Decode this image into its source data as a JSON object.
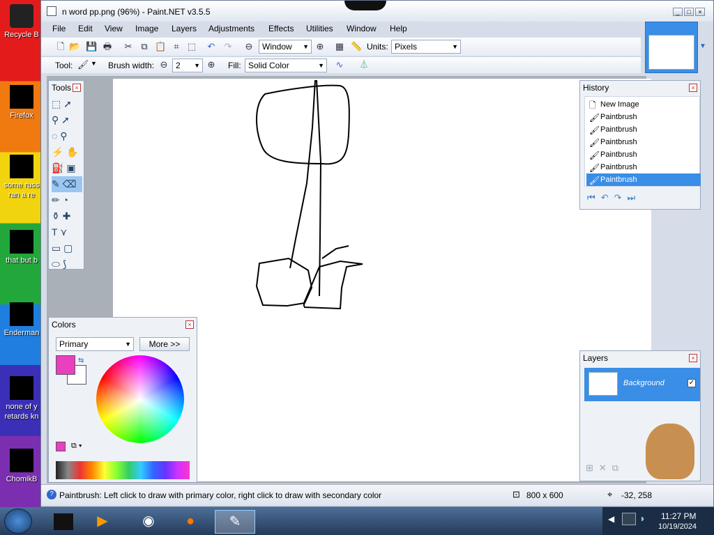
{
  "desktop": {
    "icons": [
      {
        "label": "Recycle B"
      },
      {
        "label": "Firefox"
      },
      {
        "label": "some russ\nran a re"
      },
      {
        "label": "that but b"
      },
      {
        "label": "Enderman"
      },
      {
        "label": "none of y\nretards kn"
      },
      {
        "label": "ChomikB"
      }
    ]
  },
  "window": {
    "title": "n word pp.png (96%) - Paint.NET v3.5.5",
    "controls": [
      "_",
      "□",
      "×"
    ]
  },
  "menu": [
    "File",
    "Edit",
    "View",
    "Image",
    "Layers",
    "Adjustments",
    "Effects",
    "Utilities",
    "Window",
    "Help"
  ],
  "toolbar": {
    "zoom_value": "Window",
    "units_label": "Units:",
    "units_value": "Pixels",
    "tool_label": "Tool:",
    "brush_width_label": "Brush width:",
    "brush_width_value": "2",
    "fill_label": "Fill:",
    "fill_value": "Solid Color"
  },
  "tools": {
    "title": "Tools"
  },
  "history": {
    "title": "History",
    "items": [
      "New Image",
      "Paintbrush",
      "Paintbrush",
      "Paintbrush",
      "Paintbrush",
      "Paintbrush",
      "Paintbrush"
    ],
    "selected_index": 6
  },
  "colors": {
    "title": "Colors",
    "selector_value": "Primary",
    "more_label": "More >>",
    "primary_color": "#ea3fbf",
    "secondary_color": "#ffffff"
  },
  "layers": {
    "title": "Layers",
    "items": [
      {
        "name": "Background",
        "visible": true
      }
    ]
  },
  "status": {
    "hint": "Paintbrush: Left click to draw with primary color, right click to draw with secondary color",
    "image_size": "800 x 600",
    "cursor_pos": "-32, 258"
  },
  "taskbar": {
    "time": "11:27 PM",
    "date": "10/19/2024"
  }
}
